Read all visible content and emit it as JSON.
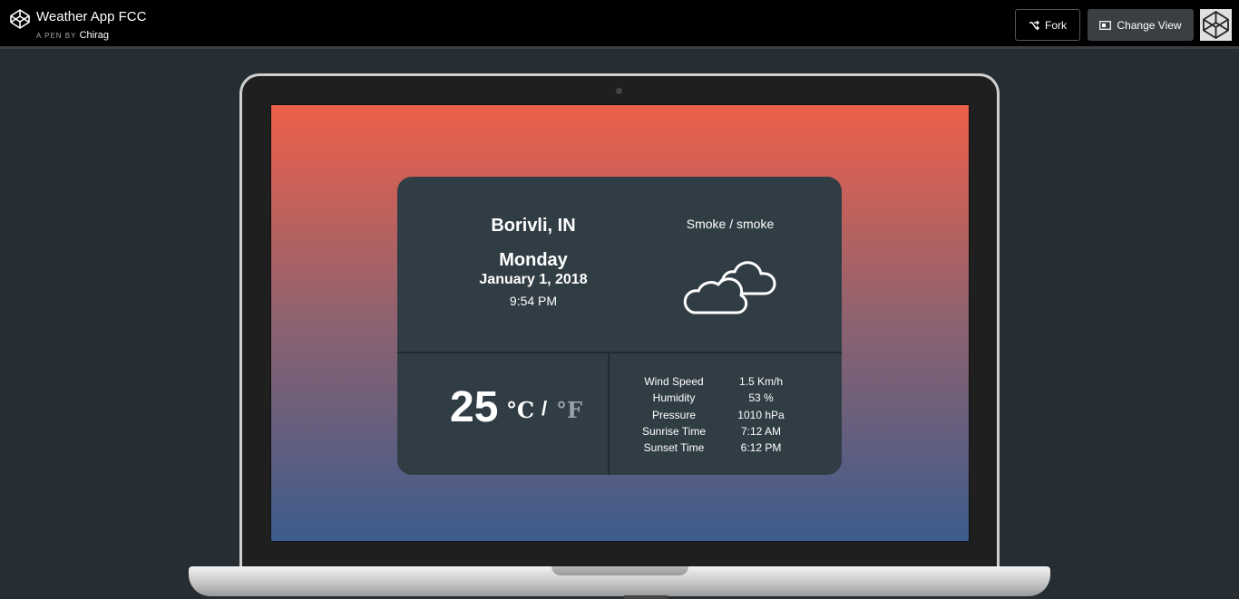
{
  "header": {
    "title": "Weather App FCC",
    "by_label": "A PEN BY",
    "author": "Chirag",
    "fork_label": "Fork",
    "change_view_label": "Change View",
    "logo_icon": "codepen-logo-icon",
    "fork_icon": "fork-icon",
    "change_view_icon": "layout-icon"
  },
  "weather": {
    "location": "Borivli, IN",
    "day": "Monday",
    "date": "January 1, 2018",
    "time": "9:54 PM",
    "description": "Smoke / smoke",
    "icon": "cloud-icon",
    "temperature": "25",
    "unit_c": "°C",
    "slash": "/",
    "unit_f": "°F",
    "stats": [
      {
        "label": "Wind Speed",
        "value": "1.5 Km/h"
      },
      {
        "label": "Humidity",
        "value": "53 %"
      },
      {
        "label": "Pressure",
        "value": "1010 hPa"
      },
      {
        "label": "Sunrise Time",
        "value": "7:12 AM"
      },
      {
        "label": "Sunset Time",
        "value": "6:12 PM"
      }
    ]
  },
  "colors": {
    "gradient_top": "#ee604a",
    "gradient_bottom": "#3d5c8c",
    "card": "#313d45",
    "fahrenheit": "#95a2ac"
  }
}
